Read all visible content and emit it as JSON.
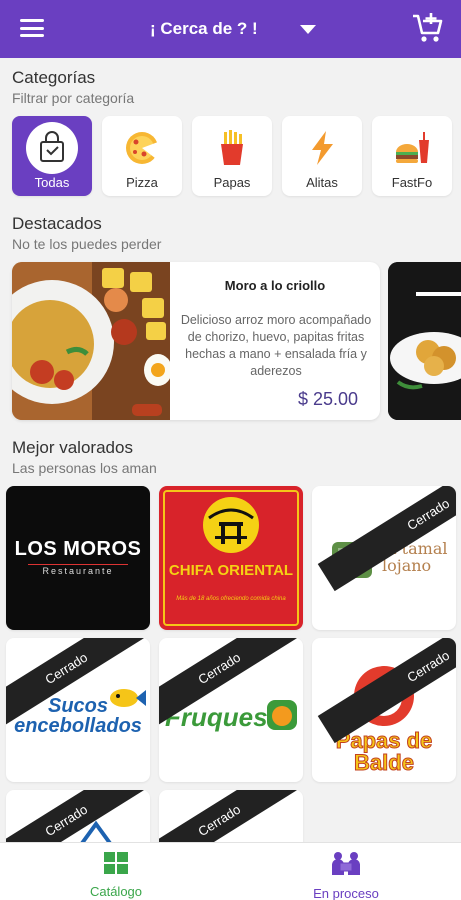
{
  "colors": {
    "primary": "#6a3fc1",
    "accent_green": "#3aa64a",
    "price": "#4a3b8c"
  },
  "header": {
    "location_label": "¡ Cerca de ? !",
    "menu_icon": "hamburger-icon",
    "cart_icon": "add-to-cart-icon"
  },
  "categories": {
    "title": "Categorías",
    "subtitle": "Filtrar por categoría",
    "items": [
      {
        "label": "Todas",
        "icon": "shopping-bag-icon",
        "selected": true
      },
      {
        "label": "Pizza",
        "icon": "pizza-icon",
        "selected": false
      },
      {
        "label": "Papas",
        "icon": "fries-icon",
        "selected": false
      },
      {
        "label": "Alitas",
        "icon": "lightning-icon",
        "selected": false
      },
      {
        "label": "FastFo",
        "icon": "fast-food-icon",
        "selected": false
      }
    ]
  },
  "featured": {
    "title": "Destacados",
    "subtitle": "No te los puedes perder",
    "items": [
      {
        "name": "Moro a lo criollo",
        "description": "Delicioso arroz moro acompañado de chorizo, huevo, papitas fritas hechas a mano + ensalada fría y aderezos",
        "price": "$ 25.00"
      }
    ]
  },
  "top_rated": {
    "title": "Mejor valorados",
    "subtitle": "Las personas los aman",
    "closed_label": "Cerrado",
    "restaurants": [
      {
        "logo_text": "LOS MOROS",
        "logo_sub": "Restaurante",
        "closed": false
      },
      {
        "logo_text": "CHIFA ORIENTAL",
        "logo_sub": "Más de 18 años ofreciendo comida china",
        "closed": false
      },
      {
        "logo_text": "el tamal lojano",
        "closed": true
      },
      {
        "logo_text": "Sucos encebollados",
        "closed": true
      },
      {
        "logo_text": "Fruques",
        "closed": true
      },
      {
        "logo_text": "Papas de Balde",
        "closed": true
      },
      {
        "logo_text": "",
        "closed": true
      },
      {
        "logo_text": "",
        "closed": true
      }
    ]
  },
  "bottom_nav": {
    "items": [
      {
        "label": "Catálogo",
        "icon": "grid-icon",
        "active": true
      },
      {
        "label": "En proceso",
        "icon": "delivery-people-icon",
        "active": false
      }
    ]
  }
}
